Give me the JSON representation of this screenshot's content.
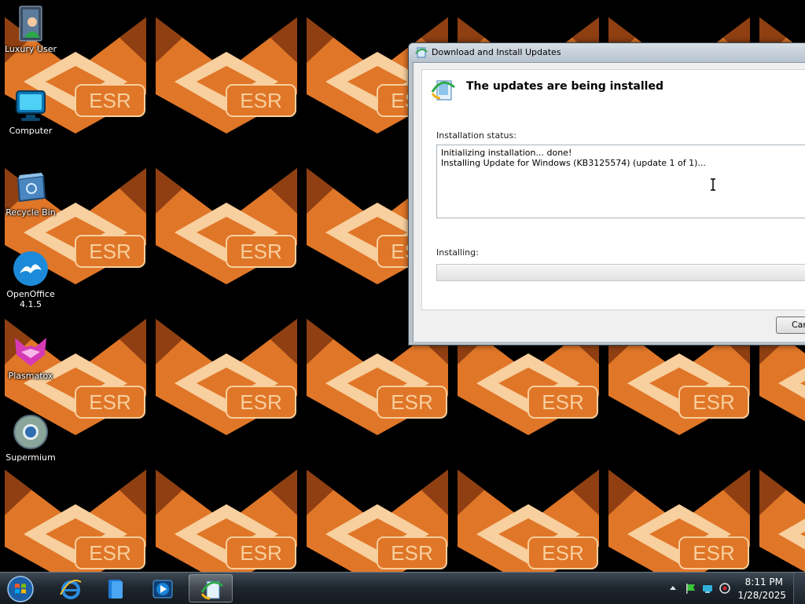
{
  "wallpaper": {
    "tile_text": "ESR",
    "colors": {
      "orange": "#e07628",
      "light": "#f8cf9e",
      "dark": "#8f3f12"
    }
  },
  "desktop_icons": [
    {
      "label": "Luxury User",
      "icon": "user-icon"
    },
    {
      "label": "Computer",
      "icon": "computer-icon"
    },
    {
      "label": "Recycle Bin",
      "icon": "recycle-bin-icon"
    },
    {
      "label": "OpenOffice\n4.1.5",
      "icon": "openoffice-icon"
    },
    {
      "label": "Plasmatox",
      "icon": "plasmatox-icon"
    },
    {
      "label": "Supermium",
      "icon": "supermium-icon"
    }
  ],
  "dialog": {
    "title": "Download and Install Updates",
    "heading": "The updates are being installed",
    "status_label": "Installation status:",
    "status_lines": [
      "Initializing installation... done!",
      "Installing Update for Windows (KB3125574) (update 1 of 1)..."
    ],
    "installing_label": "Installing:",
    "progress": 0,
    "cancel_label": "Cance"
  },
  "taskbar": {
    "pinned": [
      {
        "name": "internet-explorer",
        "icon": "ie-icon"
      },
      {
        "name": "file-explorer",
        "icon": "folder-icon"
      },
      {
        "name": "media-player",
        "icon": "media-player-icon"
      },
      {
        "name": "windows-update",
        "icon": "update-icon",
        "active": true
      }
    ],
    "clock": {
      "time": "8:11 PM",
      "date": "1/28/2025"
    }
  }
}
